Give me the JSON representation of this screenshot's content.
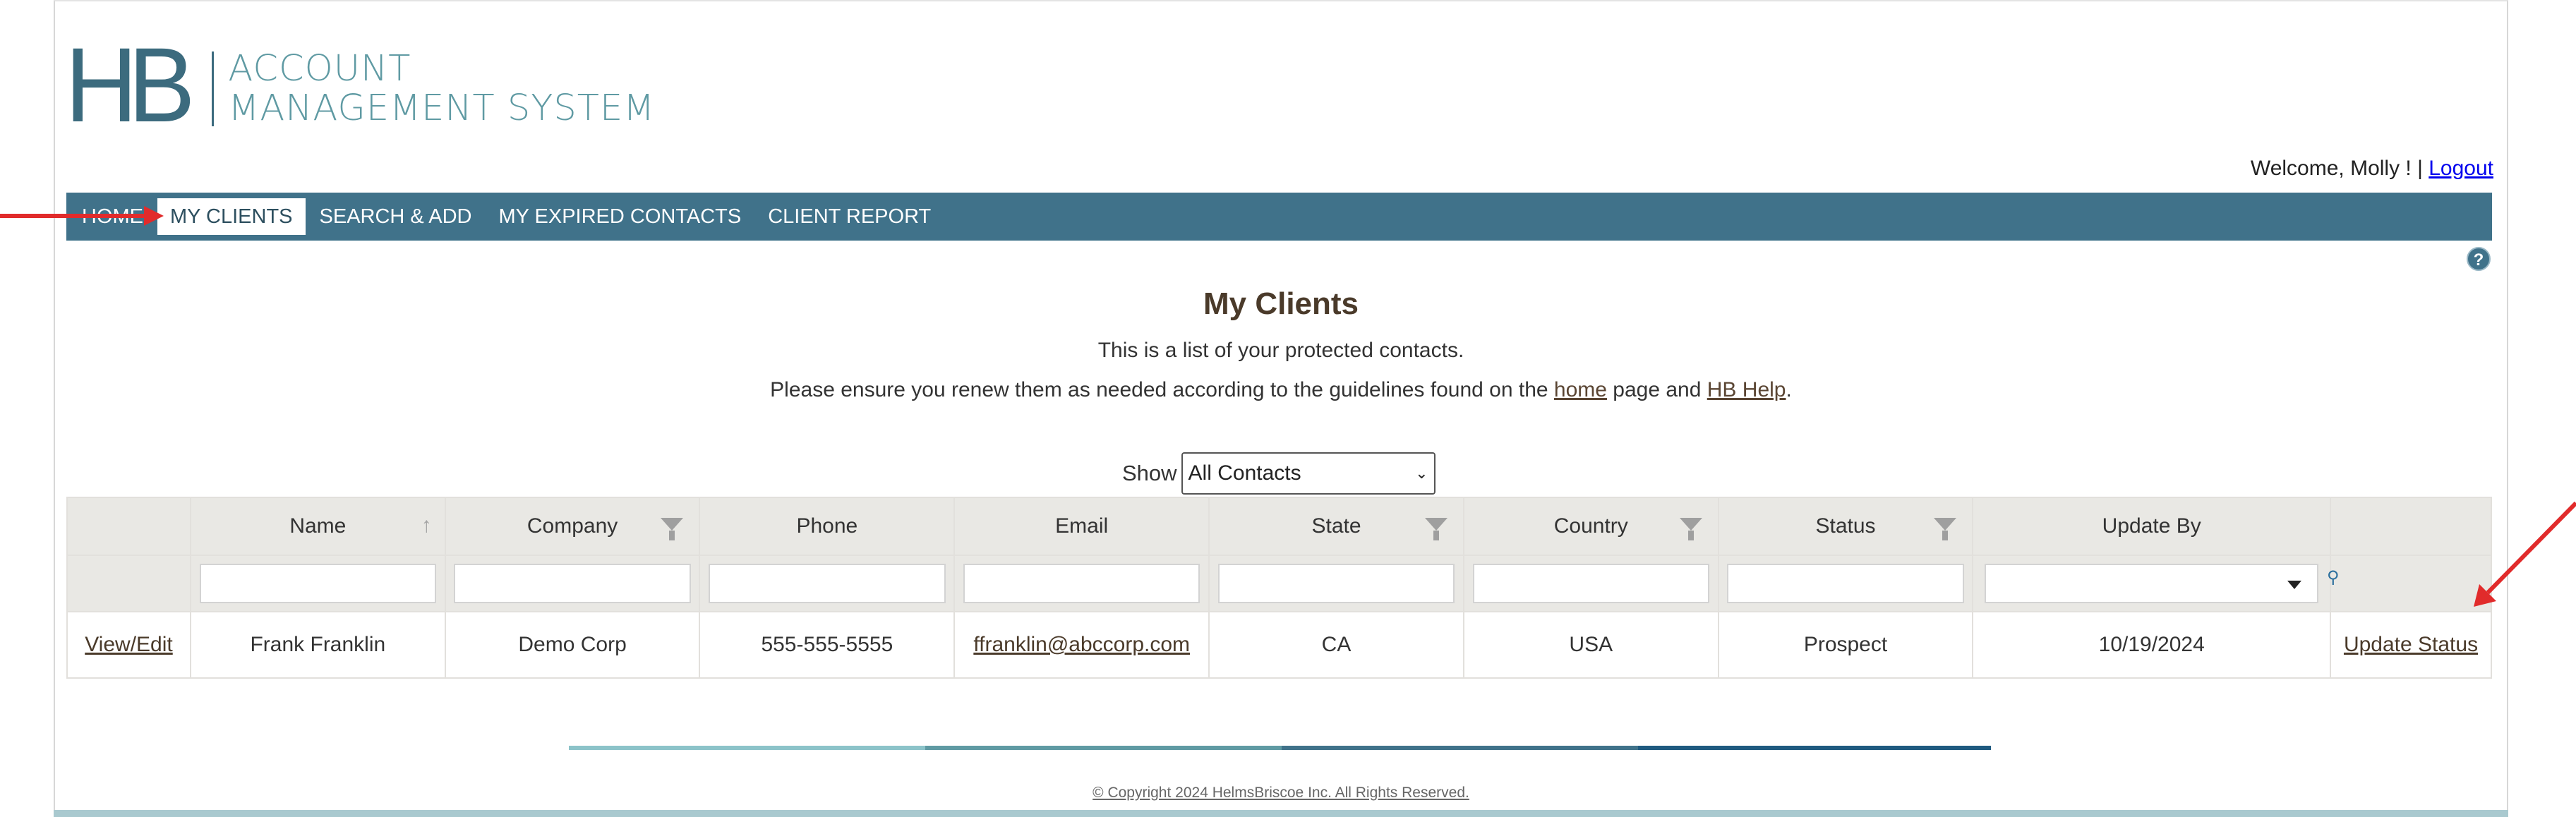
{
  "logo": {
    "mark": "HB",
    "line1": "ACCOUNT",
    "line2": "MANAGEMENT SYSTEM"
  },
  "header": {
    "welcome_text": "Welcome, Molly ! |",
    "logout_label": "Logout"
  },
  "nav": {
    "items": [
      {
        "label": "HOME",
        "active": false
      },
      {
        "label": "MY CLIENTS",
        "active": true
      },
      {
        "label": "SEARCH & ADD",
        "active": false
      },
      {
        "label": "MY EXPIRED CONTACTS",
        "active": false
      },
      {
        "label": "CLIENT REPORT",
        "active": false
      }
    ]
  },
  "page": {
    "title": "My Clients",
    "subtitle1": "This is a list of your protected contacts.",
    "subtitle2_prefix": "Please ensure you renew them as needed according to the guidelines found on the ",
    "subtitle2_link1": "home",
    "subtitle2_mid": " page and ",
    "subtitle2_link2": "HB Help",
    "subtitle2_suffix": "."
  },
  "filter": {
    "show_label": "Show",
    "selected": "All Contacts"
  },
  "table": {
    "columns": [
      "",
      "Name",
      "Company",
      "Phone",
      "Email",
      "State",
      "Country",
      "Status",
      "Update By",
      ""
    ],
    "rows": [
      {
        "action": "View/Edit",
        "name": "Frank Franklin",
        "company": "Demo Corp",
        "phone": "555-555-5555",
        "email": "ffranklin@abccorp.com",
        "state": "CA",
        "country": "USA",
        "status": "Prospect",
        "update_by": "10/19/2024",
        "update_status": "Update Status"
      }
    ]
  },
  "footer": {
    "copyright": "© Copyright 2024 HelmsBriscoe Inc. All Rights Reserved."
  },
  "colors": {
    "nav_bg": "#40728a",
    "accent": "#5f9aa3",
    "arrow": "#e12b2b",
    "deco_bar": [
      "#8cc3c9",
      "#5f9aa3",
      "#40728a",
      "#1f5a80"
    ]
  },
  "icons": {
    "help": "help-icon",
    "sort": "sort-ascending-icon",
    "filter": "funnel-icon",
    "dropdown": "chevron-down-icon"
  }
}
